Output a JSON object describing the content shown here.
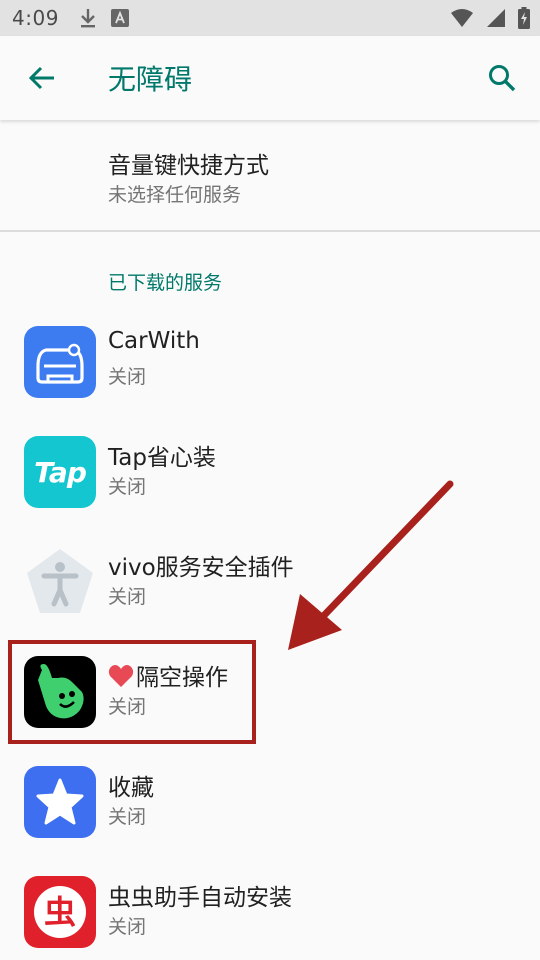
{
  "status_bar": {
    "time": "4:09",
    "icons_left": [
      "download-icon",
      "text-a-icon"
    ],
    "icons_right": [
      "wifi-icon",
      "cell-signal-icon",
      "battery-charging-icon"
    ]
  },
  "app_bar": {
    "title": "无障碍",
    "back_icon": "arrow-back-icon",
    "search_icon": "search-icon",
    "accent": "#00796b"
  },
  "shortcut": {
    "title": "音量键快捷方式",
    "subtitle": "未选择任何服务"
  },
  "section": {
    "header": "已下载的服务"
  },
  "services": [
    {
      "name": "CarWith",
      "status": "关闭",
      "icon": "carwith-app-icon",
      "color": "#3d7cf0"
    },
    {
      "name": "Tap省心装",
      "status": "关闭",
      "icon": "tap-app-icon",
      "label": "Tap",
      "color": "#14c6d0"
    },
    {
      "name": "vivo服务安全插件",
      "status": "关闭",
      "icon": "accessibility-app-icon",
      "color": "#e3e8ec"
    },
    {
      "name": "隔空操作",
      "status": "关闭",
      "icon": "gesture-hand-app-icon",
      "heart": "heart-icon",
      "color": "#000000"
    },
    {
      "name": "收藏",
      "status": "关闭",
      "icon": "star-app-icon",
      "color": "#3d6ff0"
    },
    {
      "name": "虫虫助手自动安装",
      "status": "关闭",
      "icon": "chongchong-app-icon",
      "label": "虫",
      "color": "#e0202a"
    }
  ],
  "annotation": {
    "highlight_color": "#a8211c"
  }
}
